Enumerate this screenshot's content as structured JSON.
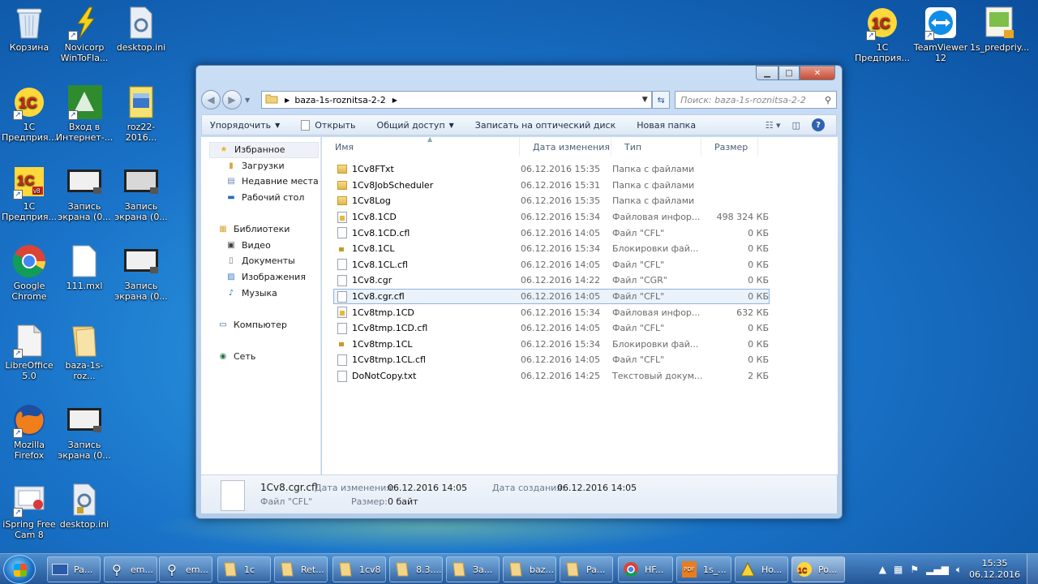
{
  "colors": {
    "accent": "#1a74c9",
    "selection": "#eaf2fc",
    "close": "#c44d36"
  },
  "desktop": {
    "icons": [
      {
        "label": "Корзина",
        "icon": "recycle-bin-icon"
      },
      {
        "label": "Novicorp WinToFla...",
        "icon": "wintoflash-icon"
      },
      {
        "label": "desktop.ini",
        "icon": "settings-file-icon"
      },
      {
        "label": "1C Предприя...",
        "icon": "1c-icon"
      },
      {
        "label": "Вход в Интернет-...",
        "icon": "internet-login-icon"
      },
      {
        "label": "roz22-2016...",
        "icon": "archive-icon"
      },
      {
        "label": "1C Предприя...",
        "icon": "1c-v8-icon"
      },
      {
        "label": "Запись экрана (0...",
        "icon": "screen-recording-icon"
      },
      {
        "label": "Запись экрана (0...",
        "icon": "screen-recording-icon"
      },
      {
        "label": "Google Chrome",
        "icon": "chrome-icon"
      },
      {
        "label": "111.mxl",
        "icon": "file-icon"
      },
      {
        "label": "Запись экрана (0...",
        "icon": "screen-recording-icon"
      },
      {
        "label": "LibreOffice 5.0",
        "icon": "libreoffice-icon"
      },
      {
        "label": "baza-1s-roz...",
        "icon": "folder-icon"
      },
      {
        "label": "Mozilla Firefox",
        "icon": "firefox-icon"
      },
      {
        "label": "Запись экрана (0...",
        "icon": "screen-recording-icon"
      },
      {
        "label": "iSpring Free Cam 8",
        "icon": "ispring-icon"
      },
      {
        "label": "desktop.ini",
        "icon": "settings-file-icon"
      },
      {
        "label": "1C Предприя...",
        "icon": "1c-icon"
      },
      {
        "label": "TeamViewer 12",
        "icon": "teamviewer-icon"
      },
      {
        "label": "1s_predpriy...",
        "icon": "installer-icon"
      }
    ]
  },
  "explorer": {
    "address": {
      "path": "baza-1s-roznitsa-2-2"
    },
    "search": {
      "placeholder": "Поиск: baza-1s-roznitsa-2-2"
    },
    "toolbar": {
      "organize": "Упорядочить",
      "open": "Открыть",
      "share": "Общий доступ",
      "burn": "Записать на оптический диск",
      "new_folder": "Новая папка"
    },
    "nav": {
      "favorites": "Избранное",
      "downloads": "Загрузки",
      "recent": "Недавние места",
      "desktop": "Рабочий стол",
      "libraries": "Библиотеки",
      "video": "Видео",
      "documents": "Документы",
      "pictures": "Изображения",
      "music": "Музыка",
      "computer": "Компьютер",
      "network": "Сеть"
    },
    "columns": {
      "name": "Имя",
      "date": "Дата изменения",
      "type": "Тип",
      "size": "Размер"
    },
    "files": [
      {
        "name": "1Cv8FTxt",
        "date": "06.12.2016 15:35",
        "type": "Папка с файлами",
        "size": "",
        "kind": "folder"
      },
      {
        "name": "1Cv8JobScheduler",
        "date": "06.12.2016 15:31",
        "type": "Папка с файлами",
        "size": "",
        "kind": "folder"
      },
      {
        "name": "1Cv8Log",
        "date": "06.12.2016 15:35",
        "type": "Папка с файлами",
        "size": "",
        "kind": "folder"
      },
      {
        "name": "1Cv8.1CD",
        "date": "06.12.2016 15:34",
        "type": "Файловая инфор...",
        "size": "498 324 КБ",
        "kind": "db"
      },
      {
        "name": "1Cv8.1CD.cfl",
        "date": "06.12.2016 14:05",
        "type": "Файл \"CFL\"",
        "size": "0 КБ",
        "kind": "file"
      },
      {
        "name": "1Cv8.1CL",
        "date": "06.12.2016 15:34",
        "type": "Блокировки фай...",
        "size": "0 КБ",
        "kind": "lock"
      },
      {
        "name": "1Cv8.1CL.cfl",
        "date": "06.12.2016 14:05",
        "type": "Файл \"CFL\"",
        "size": "0 КБ",
        "kind": "file"
      },
      {
        "name": "1Cv8.cgr",
        "date": "06.12.2016 14:22",
        "type": "Файл \"CGR\"",
        "size": "0 КБ",
        "kind": "file"
      },
      {
        "name": "1Cv8.cgr.cfl",
        "date": "06.12.2016 14:05",
        "type": "Файл \"CFL\"",
        "size": "0 КБ",
        "kind": "file"
      },
      {
        "name": "1Cv8tmp.1CD",
        "date": "06.12.2016 15:34",
        "type": "Файловая инфор...",
        "size": "632 КБ",
        "kind": "db"
      },
      {
        "name": "1Cv8tmp.1CD.cfl",
        "date": "06.12.2016 14:05",
        "type": "Файл \"CFL\"",
        "size": "0 КБ",
        "kind": "file"
      },
      {
        "name": "1Cv8tmp.1CL",
        "date": "06.12.2016 15:34",
        "type": "Блокировки фай...",
        "size": "0 КБ",
        "kind": "lock"
      },
      {
        "name": "1Cv8tmp.1CL.cfl",
        "date": "06.12.2016 14:05",
        "type": "Файл \"CFL\"",
        "size": "0 КБ",
        "kind": "file"
      },
      {
        "name": "DoNotCopy.txt",
        "date": "06.12.2016 14:25",
        "type": "Текстовый докум...",
        "size": "2 КБ",
        "kind": "file"
      }
    ],
    "selected_index": 8,
    "details": {
      "name": "1Cv8.cgr.cfl",
      "type": "Файл \"CFL\"",
      "modified_label": "Дата изменения:",
      "modified": "06.12.2016 14:05",
      "created_label": "Дата создания:",
      "created": "06.12.2016 14:05",
      "size_label": "Размер:",
      "size": "0 байт"
    }
  },
  "taskbar": {
    "buttons": [
      {
        "label": "Pa...",
        "icon": "monitor-icon"
      },
      {
        "label": "em...",
        "icon": "magnifier-icon"
      },
      {
        "label": "em...",
        "icon": "magnifier-icon"
      },
      {
        "label": "1c",
        "icon": "folder-icon"
      },
      {
        "label": "Ret...",
        "icon": "folder-icon"
      },
      {
        "label": "1cv8",
        "icon": "folder-icon"
      },
      {
        "label": "8.3....",
        "icon": "folder-icon"
      },
      {
        "label": "За...",
        "icon": "folder-icon"
      },
      {
        "label": "baz...",
        "icon": "folder-icon"
      },
      {
        "label": "Pa...",
        "icon": "folder-icon"
      },
      {
        "label": "HF...",
        "icon": "chrome-icon"
      },
      {
        "label": "1s_...",
        "icon": "pdf-icon"
      },
      {
        "label": "Ho...",
        "icon": "archive-icon"
      },
      {
        "label": "Po...",
        "icon": "1c-icon"
      }
    ],
    "clock": {
      "time": "15:35",
      "date": "06.12.2016"
    }
  }
}
